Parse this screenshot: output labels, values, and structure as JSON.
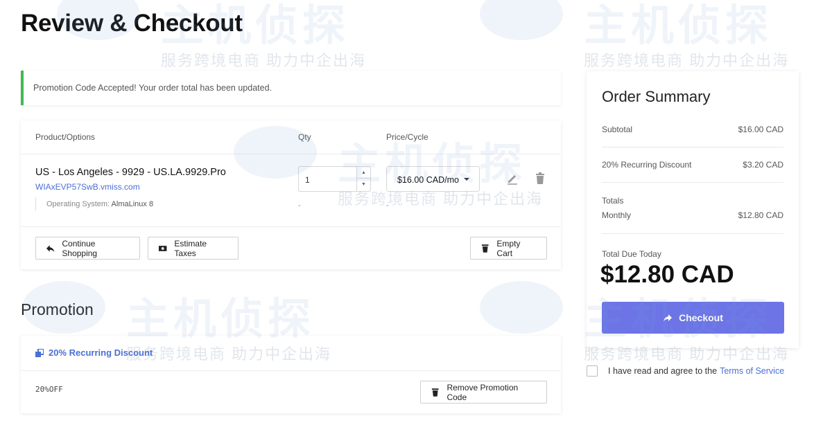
{
  "page": {
    "title": "Review & Checkout"
  },
  "alert": {
    "text": "Promotion Code Accepted! Your order total has been updated."
  },
  "cart": {
    "headers": {
      "product": "Product/Options",
      "qty": "Qty",
      "price": "Price/Cycle"
    },
    "item": {
      "name": "US - Los Angeles - 9929 - US.LA.9929.Pro",
      "domain": "WIAxEVP57SwB.vmiss.com",
      "option_label": "Operating System:",
      "option_value": "AlmaLinux 8",
      "qty": "1",
      "price": "$16.00 CAD/mo",
      "qty_dash": "-",
      "price_dash": "-"
    },
    "buttons": {
      "continue": "Continue Shopping",
      "estimate": "Estimate Taxes",
      "empty": "Empty Cart"
    }
  },
  "promotion": {
    "title": "Promotion",
    "name": "20% Recurring Discount",
    "code": "20%OFF",
    "remove_label": "Remove Promotion Code"
  },
  "summary": {
    "title": "Order Summary",
    "subtotal_label": "Subtotal",
    "subtotal_value": "$16.00 CAD",
    "discount_label": "20% Recurring Discount",
    "discount_value": "$3.20 CAD",
    "totals_label": "Totals",
    "monthly_label": "Monthly",
    "monthly_value": "$12.80 CAD",
    "due_label": "Total Due Today",
    "due_value": "$12.80 CAD",
    "checkout_label": "Checkout"
  },
  "tos": {
    "text": "I have read and agree to the",
    "link": "Terms of Service"
  },
  "watermark": {
    "big": "主机侦探",
    "small": "服务跨境电商 助力中企出海"
  },
  "colors": {
    "accent": "#6c74e6",
    "link": "#4a6fd6",
    "success": "#3fb950"
  }
}
